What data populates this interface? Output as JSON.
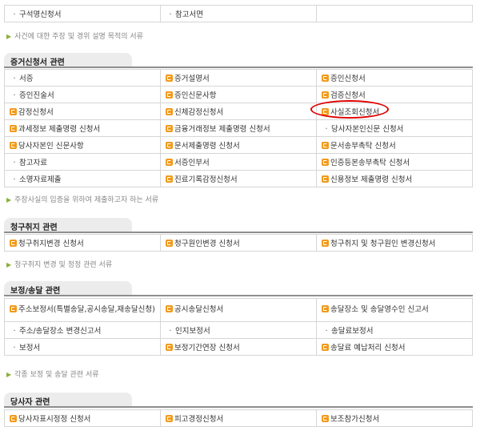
{
  "top_rows": [
    [
      {
        "icon": "bullet",
        "text": "구석명신청서"
      },
      {
        "icon": "bullet",
        "text": "참고서면"
      },
      {
        "icon": "",
        "text": ""
      }
    ]
  ],
  "top_note": "사건에 대한 주장 및 경위 설명 목적의 서류",
  "sections": {
    "evidence": {
      "title": "증거신청서 관련",
      "rows": [
        [
          {
            "icon": "bullet",
            "text": "서증"
          },
          {
            "icon": "doc",
            "text": "증거설명서"
          },
          {
            "icon": "doc",
            "text": "증인신청서"
          }
        ],
        [
          {
            "icon": "bullet",
            "text": "증인진술서"
          },
          {
            "icon": "doc",
            "text": "증인신문사항"
          },
          {
            "icon": "doc",
            "text": "검증신청서"
          }
        ],
        [
          {
            "icon": "doc",
            "text": "감정신청서"
          },
          {
            "icon": "doc",
            "text": "신체감정신청서"
          },
          {
            "icon": "doc",
            "text": "사실조회신청서"
          }
        ],
        [
          {
            "icon": "doc",
            "text": "과세정보 제출명령 신청서"
          },
          {
            "icon": "doc",
            "text": "금융거래정보 제출명령 신청서"
          },
          {
            "icon": "bullet",
            "text": "당사자본인신문 신청서"
          }
        ],
        [
          {
            "icon": "doc",
            "text": "당사자본인 신문사항"
          },
          {
            "icon": "doc",
            "text": "문서제출명령 신청서"
          },
          {
            "icon": "doc",
            "text": "문서송부촉탁 신청서"
          }
        ],
        [
          {
            "icon": "bullet",
            "text": "참고자료"
          },
          {
            "icon": "doc",
            "text": "서증인부서"
          },
          {
            "icon": "doc",
            "text": "인증등본송부촉탁 신청서"
          }
        ],
        [
          {
            "icon": "bullet",
            "text": "소명자료제출"
          },
          {
            "icon": "doc",
            "text": "진료기록감정신청서"
          },
          {
            "icon": "doc",
            "text": "신용정보 제출명령 신청서"
          }
        ]
      ],
      "note": "주장사실의 입증을 위하여 제출하고자 하는 서류"
    },
    "claim": {
      "title": "청구취지 관련",
      "rows": [
        [
          {
            "icon": "doc",
            "text": "청구취지변경 신청서"
          },
          {
            "icon": "doc",
            "text": "청구원인변경 신청서"
          },
          {
            "icon": "doc",
            "text": "청구취지 및 청구원인 변경신청서"
          }
        ]
      ],
      "note": "청구취지 변경 및 정정 관련 서류"
    },
    "service": {
      "title": "보정/송달 관련",
      "rows": [
        [
          {
            "icon": "doc",
            "text": "주소보정서(특별송달,공시송달,재송달신청)"
          },
          {
            "icon": "doc",
            "text": "공시송달신청서"
          },
          {
            "icon": "doc",
            "text": "송달장소 및 송달영수인 신고서"
          }
        ],
        [
          {
            "icon": "bullet",
            "text": "주소/송달장소 변경신고서"
          },
          {
            "icon": "bullet",
            "text": "인지보정서"
          },
          {
            "icon": "bullet",
            "text": "송달료보정서"
          }
        ],
        [
          {
            "icon": "bullet",
            "text": "보정서"
          },
          {
            "icon": "doc",
            "text": "보정기간연장 신청서"
          },
          {
            "icon": "doc",
            "text": "송달료 예납처리 신청서"
          }
        ]
      ],
      "note": "각종 보정 및 송달 관련 서류"
    },
    "party": {
      "title": "당사자 관련",
      "rows": [
        [
          {
            "icon": "doc",
            "text": "당사자표시정정 신청서"
          },
          {
            "icon": "doc",
            "text": "피고경정신청서"
          },
          {
            "icon": "doc",
            "text": "보조참가신청서"
          }
        ]
      ]
    }
  }
}
